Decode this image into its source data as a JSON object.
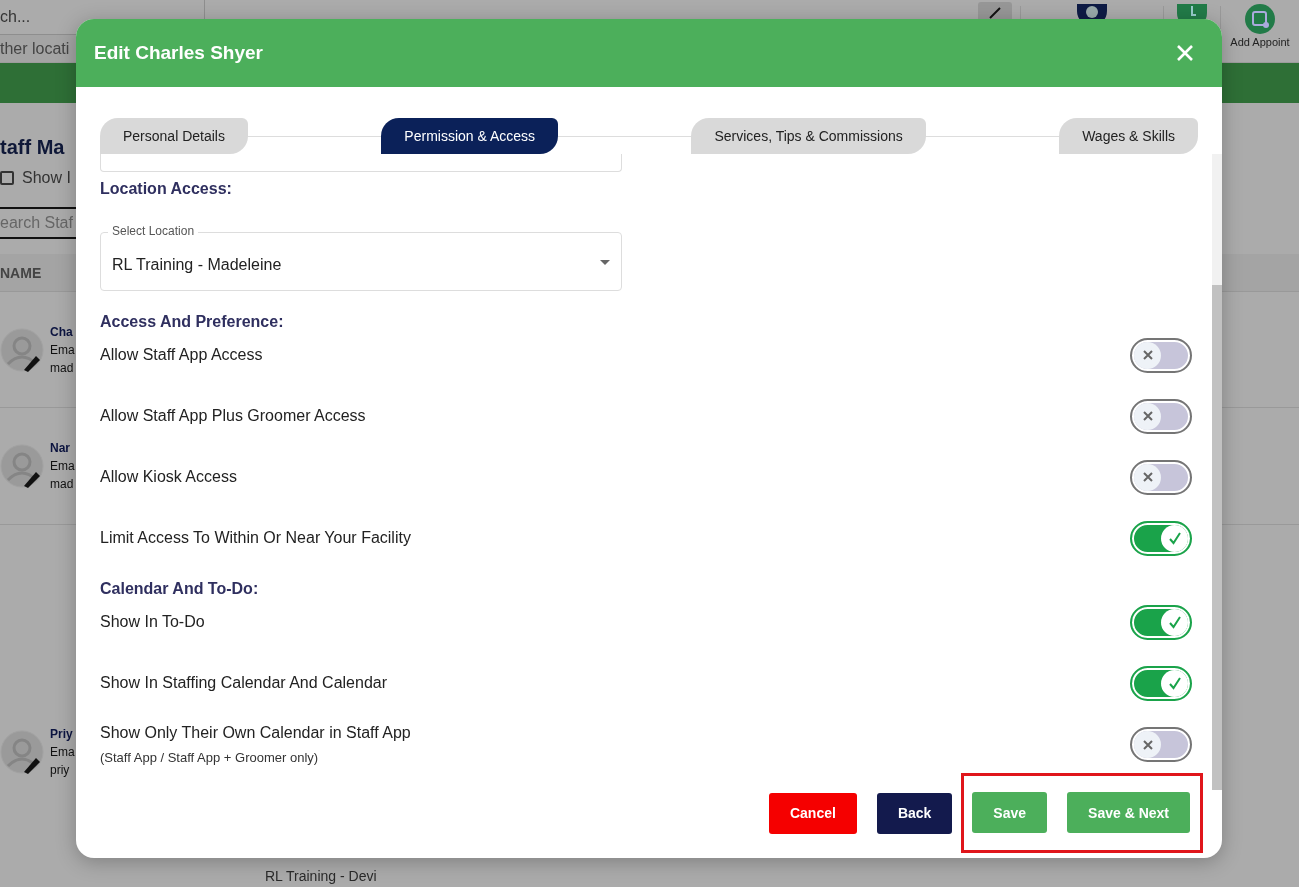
{
  "background": {
    "search_placeholder": "ch...",
    "location_select": "ther locati",
    "add_label": "Add Appoint",
    "heading": "taff Ma",
    "show_inactive": {
      "label": "Show I",
      "checked": false
    },
    "staff_search_placeholder": "earch Staf",
    "column_header": "NAME",
    "staff_rows": [
      {
        "name": "Cha",
        "line_1": "Ema",
        "line_2": "mad"
      },
      {
        "name": "Nar",
        "line_1": "Ema",
        "line_2": "mad"
      },
      {
        "name": "Priy",
        "line_1": "Ema",
        "line_2": "priy"
      }
    ],
    "footer_location": "RL Training - Devi"
  },
  "dialog": {
    "title": "Edit Charles Shyer",
    "steps": [
      {
        "label": "Personal Details",
        "selected": false
      },
      {
        "label": "Permission & Access",
        "selected": true
      },
      {
        "label": "Services, Tips & Commissions",
        "selected": false
      },
      {
        "label": "Wages & Skills",
        "selected": false
      }
    ],
    "location_heading": "Location Access:",
    "location_select": {
      "label": "Select Location",
      "value": "RL Training - Madeleine"
    },
    "sections": [
      {
        "heading": "Access And Preference:",
        "settings": [
          {
            "label": "Allow Staff App Access",
            "on": false
          },
          {
            "label": "Allow Staff App Plus Groomer Access",
            "on": false
          },
          {
            "label": "Allow Kiosk Access",
            "on": false
          },
          {
            "label": "Limit Access To Within Or Near Your Facility",
            "on": true
          }
        ]
      },
      {
        "heading": "Calendar And To-Do:",
        "settings": [
          {
            "label": "Show In To-Do",
            "on": true
          },
          {
            "label": "Show In Staffing Calendar And Calendar",
            "on": true
          },
          {
            "label": "Show Only Their Own Calendar in Staff App",
            "note": "(Staff App / Staff App + Groomer only)",
            "on": false
          }
        ]
      }
    ],
    "buttons": [
      {
        "label": "Cancel",
        "kind": "cancel",
        "highlighted": false
      },
      {
        "label": "Back",
        "kind": "back",
        "highlighted": false
      },
      {
        "label": "Save",
        "kind": "save",
        "highlighted": true
      },
      {
        "label": "Save & Next",
        "kind": "save_next",
        "highlighted": true
      }
    ]
  }
}
